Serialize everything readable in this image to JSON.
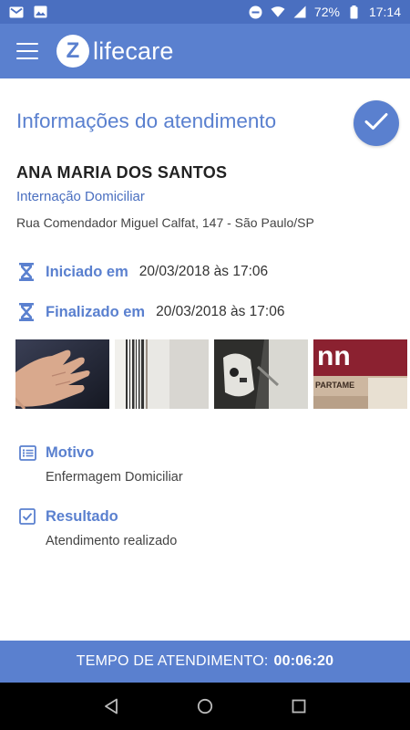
{
  "status_bar": {
    "battery": "72%",
    "time": "17:14",
    "icons": [
      "gmail-icon",
      "gallery-icon",
      "do-not-disturb-icon",
      "wifi-icon",
      "signal-icon",
      "battery-icon"
    ]
  },
  "app_bar": {
    "logo_letter": "Z",
    "logo_text": "lifecare",
    "menu_icon": "hamburger-menu-icon"
  },
  "page": {
    "title": "Informações do atendimento",
    "confirm_icon": "check-icon"
  },
  "patient": {
    "name": "ANA MARIA DOS SANTOS",
    "service_type": "Internação Domiciliar",
    "address": "Rua Comendador Miguel Calfat, 147 - São Paulo/SP"
  },
  "times": {
    "started_label": "Iniciado em",
    "started_value": "20/03/2018 às 17:06",
    "finished_label": "Finalizado em",
    "finished_value": "20/03/2018 às 17:06",
    "icon": "hourglass-icon"
  },
  "photos": [
    {
      "name": "photo-hand"
    },
    {
      "name": "photo-barcode"
    },
    {
      "name": "photo-device"
    },
    {
      "name": "photo-package",
      "text": "nn",
      "subtext": "PARTAME"
    }
  ],
  "reason": {
    "label": "Motivo",
    "value": "Enfermagem Domiciliar",
    "icon": "list-icon"
  },
  "result": {
    "label": "Resultado",
    "value": "Atendimento realizado",
    "icon": "checkbox-icon"
  },
  "footer": {
    "label": "TEMPO DE ATENDIMENTO:",
    "value": "00:06:20"
  },
  "nav": {
    "back_icon": "back-icon",
    "home_icon": "home-icon",
    "recents_icon": "recents-icon"
  },
  "colors": {
    "primary": "#5a80cf",
    "status_bar": "#4a6fc0",
    "nav_bar": "#000000"
  }
}
